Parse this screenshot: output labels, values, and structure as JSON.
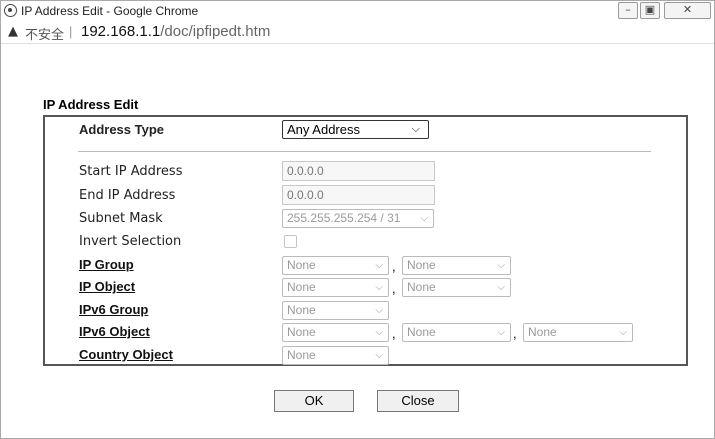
{
  "window": {
    "title": "IP Address Edit - Google Chrome",
    "insecure_label": "不安全",
    "url_host": "192.168.1.1",
    "url_path": "/doc/ipfipedt.htm",
    "icons": [
      "chrome-icon",
      "warning-triangle-icon",
      "minimize-icon",
      "maximize-icon",
      "close-icon"
    ]
  },
  "form": {
    "section_title": "IP Address Edit",
    "address_type": {
      "label": "Address Type",
      "value": "Any Address"
    },
    "start_ip": {
      "label": "Start IP Address",
      "value": "0.0.0.0"
    },
    "end_ip": {
      "label": "End IP Address",
      "value": "0.0.0.0"
    },
    "subnet_mask": {
      "label": "Subnet Mask",
      "value": "255.255.255.254 / 31"
    },
    "invert_selection": {
      "label": "Invert Selection",
      "checked": false
    },
    "ip_group": {
      "label": "IP Group",
      "values": [
        "None",
        "None"
      ]
    },
    "ip_object": {
      "label": "IP Object",
      "values": [
        "None",
        "None"
      ]
    },
    "ipv6_group": {
      "label": "IPv6 Group",
      "values": [
        "None"
      ]
    },
    "ipv6_object": {
      "label": "IPv6 Object",
      "values": [
        "None",
        "None",
        "None"
      ]
    },
    "country_object": {
      "label": "Country Object",
      "values": [
        "None"
      ]
    },
    "separator": ","
  },
  "buttons": {
    "ok": "OK",
    "close": "Close"
  },
  "glyphs": {
    "chevron": "⌵"
  }
}
